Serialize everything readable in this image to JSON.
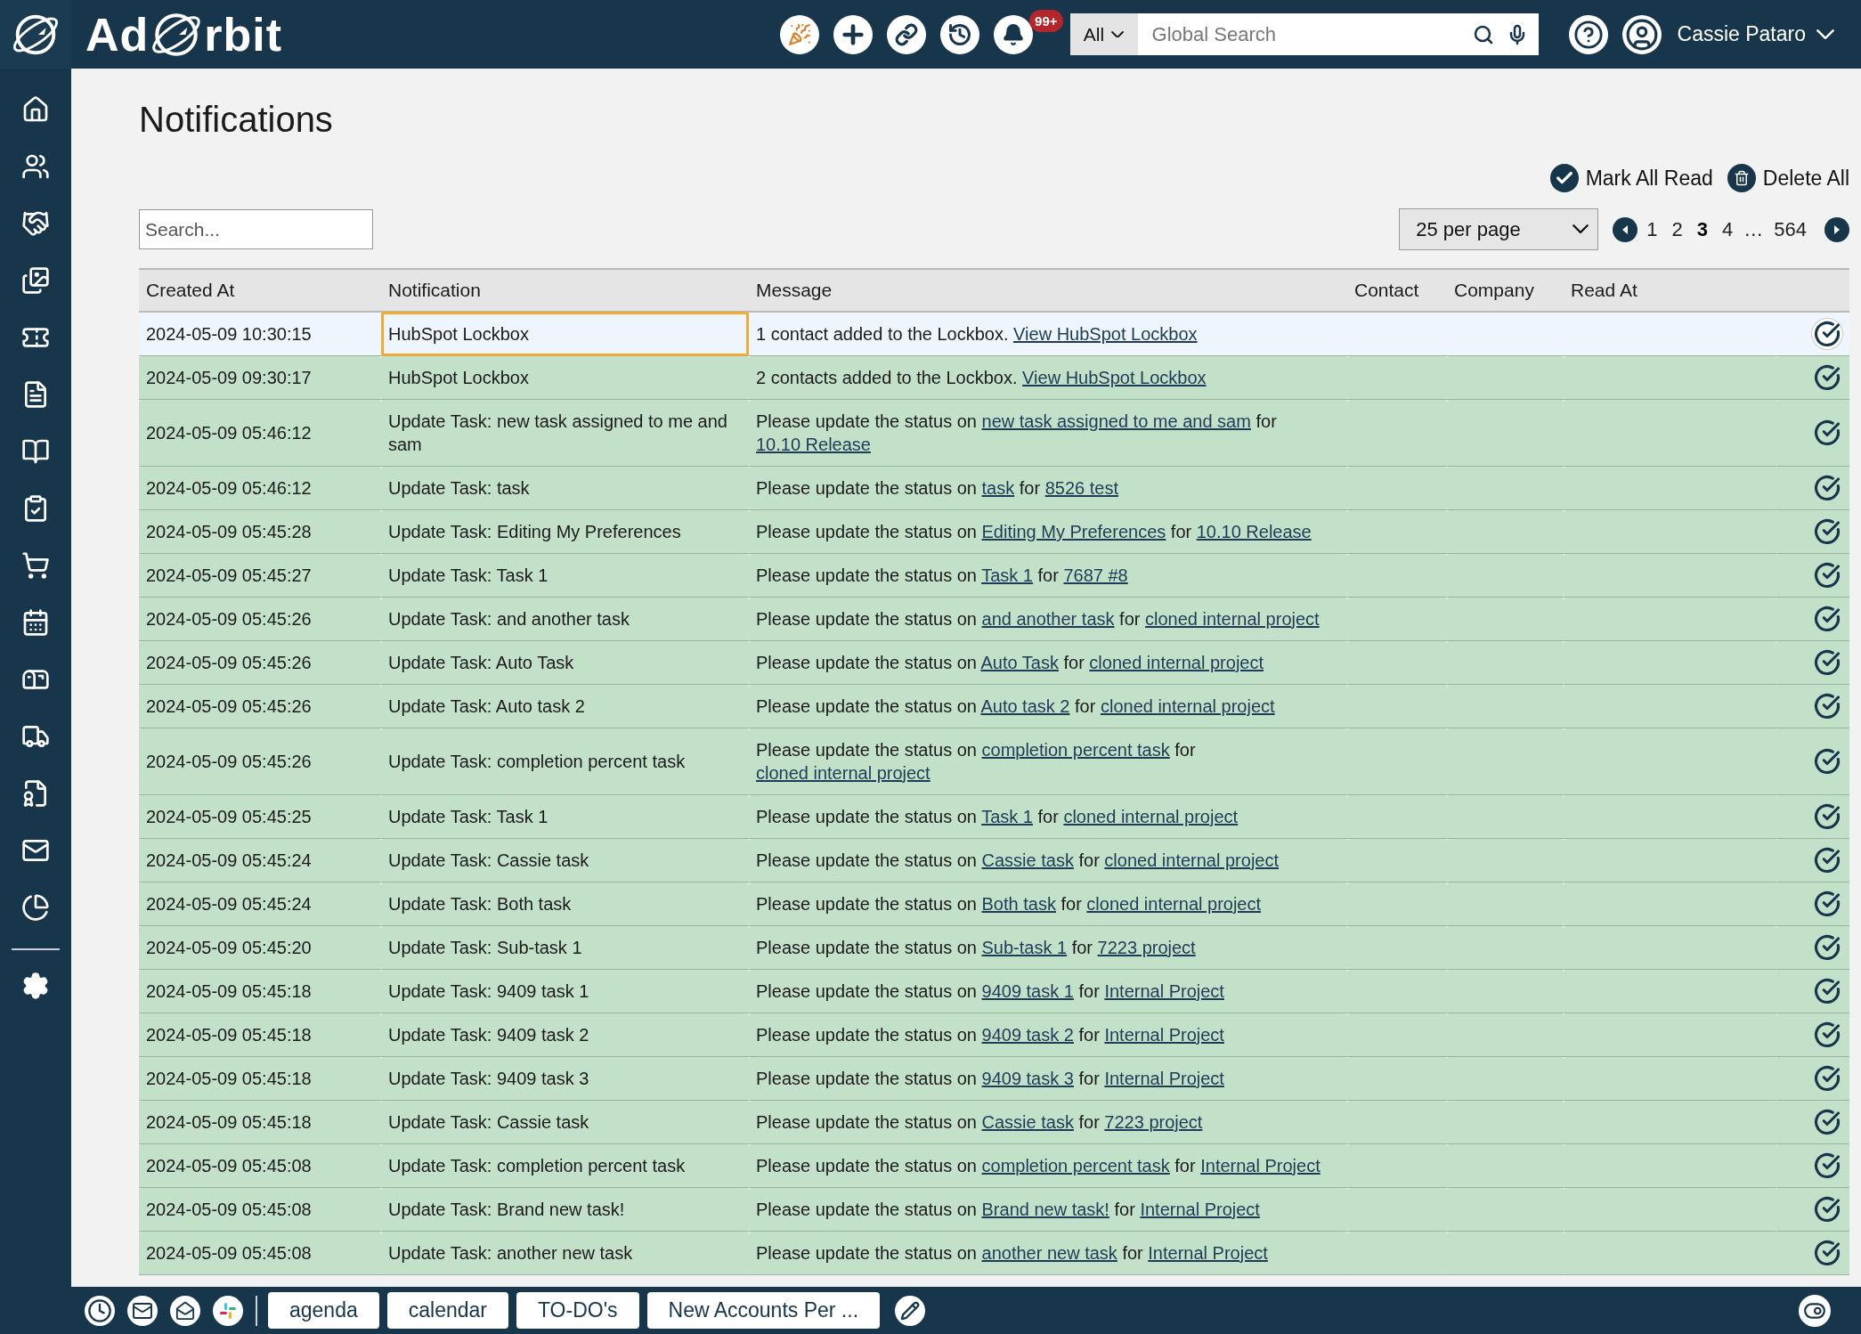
{
  "topbar": {
    "logo": {
      "left": "Ad",
      "right": "rbit"
    },
    "notification_badge": "99+",
    "search": {
      "scope": "All",
      "placeholder": "Global Search"
    },
    "user_name": "Cassie Pataro"
  },
  "page_title": "Notifications",
  "actions": [
    {
      "kind": "check",
      "label": "Mark All Read"
    },
    {
      "kind": "trash",
      "label": "Delete All"
    }
  ],
  "search": {
    "placeholder": "Search..."
  },
  "per_page": "25 per page",
  "pagination": {
    "items": [
      {
        "kind": "page",
        "label": "1",
        "selected": false
      },
      {
        "kind": "page",
        "label": "2",
        "selected": false
      },
      {
        "kind": "page",
        "label": "3",
        "selected": true
      },
      {
        "kind": "page",
        "label": "4",
        "selected": false
      },
      {
        "kind": "gap",
        "label": "…"
      },
      {
        "kind": "page",
        "label": "564",
        "selected": false
      }
    ]
  },
  "table": {
    "columns": [
      "Created At",
      "Notification",
      "Message",
      "Contact",
      "Company",
      "Read At"
    ],
    "rows": [
      {
        "created_at": "2024-05-09 10:30:15",
        "notification": "HubSpot Lockbox",
        "read": false,
        "focused": true,
        "message": [
          {
            "text": "1 contact added to the Lockbox. ",
            "link": false
          },
          {
            "text": "View HubSpot Lockbox",
            "link": true
          }
        ]
      },
      {
        "created_at": "2024-05-09 09:30:17",
        "notification": "HubSpot Lockbox",
        "read": true,
        "focused": false,
        "message": [
          {
            "text": "2 contacts added to the Lockbox. ",
            "link": false
          },
          {
            "text": "View HubSpot Lockbox",
            "link": true
          }
        ]
      },
      {
        "created_at": "2024-05-09 05:46:12",
        "notification": "Update Task: new task assigned to me and sam",
        "read": true,
        "focused": false,
        "message": [
          {
            "text": "Please update the status on ",
            "link": false
          },
          {
            "text": "new task assigned to me and sam",
            "link": true
          },
          {
            "text": " for ",
            "link": false
          },
          {
            "text": "10.10 Release",
            "link": true
          }
        ]
      },
      {
        "created_at": "2024-05-09 05:46:12",
        "notification": "Update Task: task",
        "read": true,
        "focused": false,
        "message": [
          {
            "text": "Please update the status on ",
            "link": false
          },
          {
            "text": "task",
            "link": true
          },
          {
            "text": " for ",
            "link": false
          },
          {
            "text": "8526 test",
            "link": true
          }
        ]
      },
      {
        "created_at": "2024-05-09 05:45:28",
        "notification": "Update Task: Editing My Preferences",
        "read": true,
        "focused": false,
        "message": [
          {
            "text": "Please update the status on ",
            "link": false
          },
          {
            "text": "Editing My Preferences",
            "link": true
          },
          {
            "text": " for ",
            "link": false
          },
          {
            "text": "10.10 Release",
            "link": true
          }
        ]
      },
      {
        "created_at": "2024-05-09 05:45:27",
        "notification": "Update Task: Task 1",
        "read": true,
        "focused": false,
        "message": [
          {
            "text": "Please update the status on ",
            "link": false
          },
          {
            "text": "Task 1",
            "link": true
          },
          {
            "text": " for ",
            "link": false
          },
          {
            "text": "7687 #8",
            "link": true
          }
        ]
      },
      {
        "created_at": "2024-05-09 05:45:26",
        "notification": "Update Task: and another task",
        "read": true,
        "focused": false,
        "message": [
          {
            "text": "Please update the status on ",
            "link": false
          },
          {
            "text": "and another task",
            "link": true
          },
          {
            "text": " for ",
            "link": false
          },
          {
            "text": "cloned internal project",
            "link": true
          }
        ]
      },
      {
        "created_at": "2024-05-09 05:45:26",
        "notification": "Update Task: Auto Task",
        "read": true,
        "focused": false,
        "message": [
          {
            "text": "Please update the status on ",
            "link": false
          },
          {
            "text": "Auto Task",
            "link": true
          },
          {
            "text": " for ",
            "link": false
          },
          {
            "text": "cloned internal project",
            "link": true
          }
        ]
      },
      {
        "created_at": "2024-05-09 05:45:26",
        "notification": "Update Task: Auto task 2",
        "read": true,
        "focused": false,
        "message": [
          {
            "text": "Please update the status on ",
            "link": false
          },
          {
            "text": "Auto task 2",
            "link": true
          },
          {
            "text": " for ",
            "link": false
          },
          {
            "text": "cloned internal project",
            "link": true
          }
        ]
      },
      {
        "created_at": "2024-05-09 05:45:26",
        "notification": "Update Task: completion percent task",
        "read": true,
        "focused": false,
        "message": [
          {
            "text": "Please update the status on ",
            "link": false
          },
          {
            "text": "completion percent task",
            "link": true
          },
          {
            "text": " for ",
            "link": false
          },
          {
            "text": "cloned internal project",
            "link": true
          }
        ]
      },
      {
        "created_at": "2024-05-09 05:45:25",
        "notification": "Update Task: Task 1",
        "read": true,
        "focused": false,
        "message": [
          {
            "text": "Please update the status on ",
            "link": false
          },
          {
            "text": "Task 1",
            "link": true
          },
          {
            "text": " for ",
            "link": false
          },
          {
            "text": "cloned internal project",
            "link": true
          }
        ]
      },
      {
        "created_at": "2024-05-09 05:45:24",
        "notification": "Update Task: Cassie task",
        "read": true,
        "focused": false,
        "message": [
          {
            "text": "Please update the status on ",
            "link": false
          },
          {
            "text": "Cassie task",
            "link": true
          },
          {
            "text": " for ",
            "link": false
          },
          {
            "text": "cloned internal project",
            "link": true
          }
        ]
      },
      {
        "created_at": "2024-05-09 05:45:24",
        "notification": "Update Task: Both task",
        "read": true,
        "focused": false,
        "message": [
          {
            "text": "Please update the status on ",
            "link": false
          },
          {
            "text": "Both task",
            "link": true
          },
          {
            "text": " for ",
            "link": false
          },
          {
            "text": "cloned internal project",
            "link": true
          }
        ]
      },
      {
        "created_at": "2024-05-09 05:45:20",
        "notification": "Update Task: Sub-task 1",
        "read": true,
        "focused": false,
        "message": [
          {
            "text": "Please update the status on ",
            "link": false
          },
          {
            "text": "Sub-task 1",
            "link": true
          },
          {
            "text": " for ",
            "link": false
          },
          {
            "text": "7223 project",
            "link": true
          }
        ]
      },
      {
        "created_at": "2024-05-09 05:45:18",
        "notification": "Update Task: 9409 task 1",
        "read": true,
        "focused": false,
        "message": [
          {
            "text": "Please update the status on ",
            "link": false
          },
          {
            "text": "9409 task 1",
            "link": true
          },
          {
            "text": " for ",
            "link": false
          },
          {
            "text": "Internal Project",
            "link": true
          }
        ]
      },
      {
        "created_at": "2024-05-09 05:45:18",
        "notification": "Update Task: 9409 task 2",
        "read": true,
        "focused": false,
        "message": [
          {
            "text": "Please update the status on ",
            "link": false
          },
          {
            "text": "9409 task 2",
            "link": true
          },
          {
            "text": " for ",
            "link": false
          },
          {
            "text": "Internal Project",
            "link": true
          }
        ]
      },
      {
        "created_at": "2024-05-09 05:45:18",
        "notification": "Update Task: 9409 task 3",
        "read": true,
        "focused": false,
        "message": [
          {
            "text": "Please update the status on ",
            "link": false
          },
          {
            "text": "9409 task 3",
            "link": true
          },
          {
            "text": " for ",
            "link": false
          },
          {
            "text": "Internal Project",
            "link": true
          }
        ]
      },
      {
        "created_at": "2024-05-09 05:45:18",
        "notification": "Update Task: Cassie task",
        "read": true,
        "focused": false,
        "message": [
          {
            "text": "Please update the status on ",
            "link": false
          },
          {
            "text": "Cassie task",
            "link": true
          },
          {
            "text": " for ",
            "link": false
          },
          {
            "text": "7223 project",
            "link": true
          }
        ]
      },
      {
        "created_at": "2024-05-09 05:45:08",
        "notification": "Update Task: completion percent task",
        "read": true,
        "focused": false,
        "message": [
          {
            "text": "Please update the status on ",
            "link": false
          },
          {
            "text": "completion percent task",
            "link": true
          },
          {
            "text": " for ",
            "link": false
          },
          {
            "text": "Internal Project",
            "link": true
          }
        ]
      },
      {
        "created_at": "2024-05-09 05:45:08",
        "notification": "Update Task: Brand new task!",
        "read": true,
        "focused": false,
        "message": [
          {
            "text": "Please update the status on ",
            "link": false
          },
          {
            "text": "Brand new task!",
            "link": true
          },
          {
            "text": " for ",
            "link": false
          },
          {
            "text": "Internal Project",
            "link": true
          }
        ]
      },
      {
        "created_at": "2024-05-09 05:45:08",
        "notification": "Update Task: another new task",
        "read": true,
        "focused": false,
        "message": [
          {
            "text": "Please update the status on ",
            "link": false
          },
          {
            "text": "another new task",
            "link": true
          },
          {
            "text": " for ",
            "link": false
          },
          {
            "text": "Internal Project",
            "link": true
          }
        ]
      }
    ]
  },
  "bottom_bar": {
    "tabs": [
      "agenda",
      "calendar",
      "TO-DO's",
      "New Accounts Per ..."
    ]
  }
}
